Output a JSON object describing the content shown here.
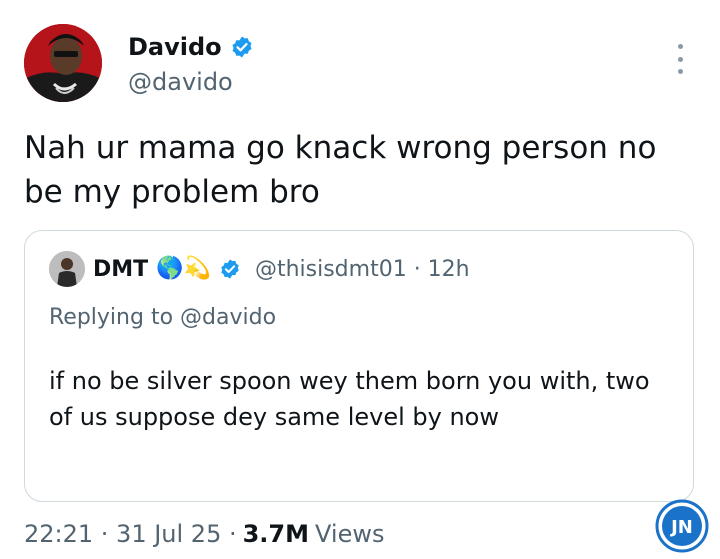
{
  "tweet": {
    "author_name": "Davido",
    "handle": "@davido",
    "text": "Nah ur mama go knack wrong person no be my problem bro",
    "timestamp": "22:21 · 31 Jul 25 ·",
    "views_count": "3.7M",
    "views_label": "Views"
  },
  "quote": {
    "author_name": "DMT",
    "name_emojis": "🌎💫",
    "handle_time": "@thisisdmt01 · 12h",
    "replying_to": "Replying to @davido",
    "text": "if no be silver spoon wey them born you with, two of us suppose dey same level by now"
  },
  "watermark": {
    "text": "JN"
  },
  "colors": {
    "verified": "#1d9bf0",
    "secondary_text": "#536471",
    "border": "#cfd9de"
  }
}
